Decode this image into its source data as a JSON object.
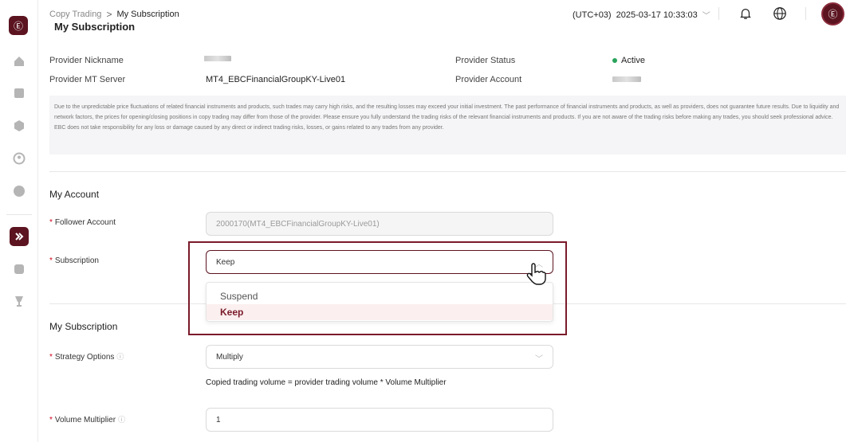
{
  "brand": {
    "logo_glyph": "Ⓔ",
    "accent_color": "#5b1420",
    "status_color": "#29a35b"
  },
  "sidebar": {
    "icons": [
      "home-icon",
      "document-icon",
      "cube-icon",
      "user-icon",
      "help-icon",
      "copy-trading-icon",
      "account-icon",
      "trophy-icon"
    ],
    "active": "copy-trading-icon"
  },
  "topbar": {
    "breadcrumb_parent": "Copy Trading",
    "breadcrumb_sep": ">",
    "breadcrumb_current": "My Subscription",
    "timezone": "(UTC+03)",
    "datetime": "2025-03-17 10:33:03",
    "avatar_glyph": "Ⓔ"
  },
  "page": {
    "title": "My Subscription"
  },
  "provider": {
    "nickname_label": "Provider Nickname",
    "server_label": "Provider MT Server",
    "server_value": "MT4_EBCFinancialGroupKY-Live01",
    "status_label": "Provider Status",
    "status_value": "Active",
    "account_label": "Provider Account"
  },
  "disclaimer": "Due to the unpredictable price fluctuations of related financial instruments and products, such trades may carry high risks, and the resulting losses may exceed your initial investment. The past performance of financial instruments and products, as well as providers, does not guarantee future results. Due to liquidity and network factors, the prices for opening/closing positions in copy trading may differ from those of the provider. Please ensure you fully understand the trading risks of the relevant financial instruments and products. If you are not aware of the trading risks before making any trades, you should seek professional advice. EBC does not take responsibility for any loss or damage caused by any direct or indirect trading risks, losses, or gains related to any trades from any provider.",
  "my_account": {
    "title": "My Account",
    "follower_label": "Follower Account",
    "follower_value": "2000170(MT4_EBCFinancialGroupKY-Live01)",
    "subscription_label": "Subscription",
    "subscription_value": "Keep",
    "options": [
      "Suspend",
      "Keep"
    ]
  },
  "my_subscription": {
    "title": "My Subscription",
    "strategy_label": "Strategy Options",
    "strategy_value": "Multiply",
    "strategy_hint": "Copied trading volume = provider trading volume * Volume Multiplier",
    "multiplier_label": "Volume Multiplier",
    "multiplier_value": "1"
  },
  "required_mark": "*",
  "help_glyph": "ⓘ"
}
